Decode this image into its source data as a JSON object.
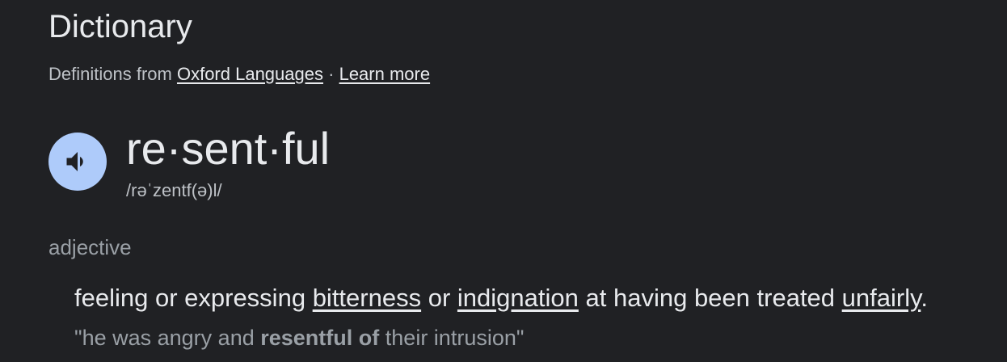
{
  "header": {
    "title": "Dictionary",
    "definitions_from": "Definitions from",
    "source_link": "Oxford Languages",
    "separator": "·",
    "learn_more": "Learn more"
  },
  "entry": {
    "headword": "re·sent·ful",
    "phonetic": "/rəˈzentf(ə)l/",
    "speaker_icon": "speaker-icon",
    "part_of_speech": "adjective",
    "definition": {
      "text_1": "feeling or expressing",
      "link_1": "bitterness",
      "text_2": "or",
      "link_2": "indignation",
      "text_3": "at having been treated",
      "link_3": "unfairly",
      "text_4": "."
    },
    "example": {
      "before": "\"he was angry and",
      "bold": "resentful of",
      "after": "their intrusion\""
    }
  },
  "colors": {
    "background": "#202124",
    "speaker_button": "#aecbfa",
    "text_primary": "#e8eaed",
    "text_secondary": "#9aa0a6"
  }
}
